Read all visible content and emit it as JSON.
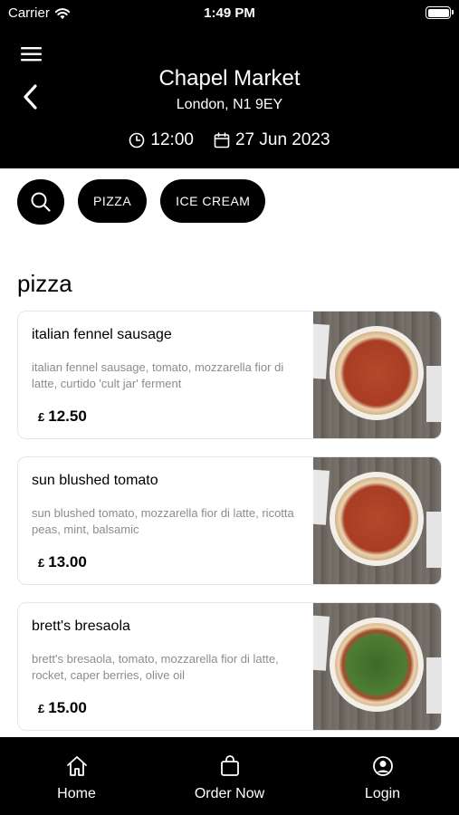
{
  "status_bar": {
    "carrier": "Carrier",
    "time": "1:49 PM"
  },
  "header": {
    "title": "Chapel Market",
    "subtitle": "London, N1 9EY",
    "time": "12:00",
    "date": "27 Jun 2023"
  },
  "filters": {
    "chips": [
      "PIZZA",
      "ICE CREAM"
    ]
  },
  "section": {
    "title": "pizza"
  },
  "items": [
    {
      "name": "italian fennel sausage",
      "description": "italian fennel sausage, tomato, mozzarella fior di latte, curtido 'cult jar' ferment",
      "currency": "£",
      "price": "12.50"
    },
    {
      "name": "sun blushed tomato",
      "description": "sun blushed tomato, mozzarella fior di latte, ricotta peas, mint, balsamic",
      "currency": "£",
      "price": "13.00"
    },
    {
      "name": "brett's bresaola",
      "description": "brett's bresaola, tomato, mozzarella fior di latte, rocket, caper berries, olive oil",
      "currency": "£",
      "price": "15.00"
    }
  ],
  "tabbar": {
    "home": "Home",
    "order": "Order Now",
    "login": "Login"
  },
  "colors": {
    "background": "#000000",
    "accent": "#ffffff",
    "muted_text": "#8c8c8c"
  }
}
